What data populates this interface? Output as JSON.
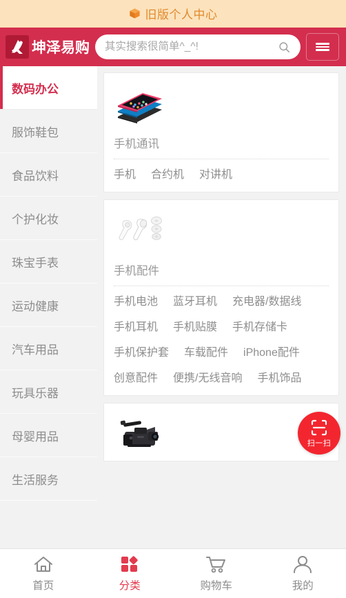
{
  "promo": {
    "icon": "cube-icon",
    "text": "旧版个人中心"
  },
  "header": {
    "logo_text": "坤泽易购",
    "logo_mark": "k-logo-icon",
    "search": {
      "value": "",
      "placeholder": "其实搜索很简单^_^!",
      "icon": "search-icon"
    },
    "menu_icon": "hamburger-menu-icon",
    "background_color": "#d32e4e"
  },
  "sidebar": {
    "items": [
      {
        "label": "数码办公",
        "active": true
      },
      {
        "label": "服饰鞋包",
        "active": false
      },
      {
        "label": "食品饮料",
        "active": false
      },
      {
        "label": "个护化妆",
        "active": false
      },
      {
        "label": "珠宝手表",
        "active": false
      },
      {
        "label": "运动健康",
        "active": false
      },
      {
        "label": "汽车用品",
        "active": false
      },
      {
        "label": "玩具乐器",
        "active": false
      },
      {
        "label": "母婴用品",
        "active": false
      },
      {
        "label": "生活服务",
        "active": false
      }
    ],
    "active_color": "#d32e4e"
  },
  "categories": [
    {
      "title": "手机通讯",
      "thumb": "stacked-phones-image",
      "links": [
        "手机",
        "合约机",
        "对讲机"
      ]
    },
    {
      "title": "手机配件",
      "thumb": "earbuds-image",
      "links": [
        "手机电池",
        "蓝牙耳机",
        "充电器/数据线",
        "手机耳机",
        "手机贴膜",
        "手机存储卡",
        "手机保护套",
        "车载配件",
        "iPhone配件",
        "创意配件",
        "便携/无线音响",
        "手机饰品"
      ]
    },
    {
      "title": "",
      "thumb": "camcorder-image",
      "links": []
    }
  ],
  "scan_button": {
    "label": "扫一扫",
    "icon": "scan-frame-icon",
    "color": "#f3262f"
  },
  "tabbar": {
    "items": [
      {
        "label": "首页",
        "icon": "home-icon",
        "active": false
      },
      {
        "label": "分类",
        "icon": "grid-category-icon",
        "active": true
      },
      {
        "label": "购物车",
        "icon": "shopping-cart-icon",
        "active": false
      },
      {
        "label": "我的",
        "icon": "user-profile-icon",
        "active": false
      }
    ],
    "active_color": "#e23b4e"
  }
}
